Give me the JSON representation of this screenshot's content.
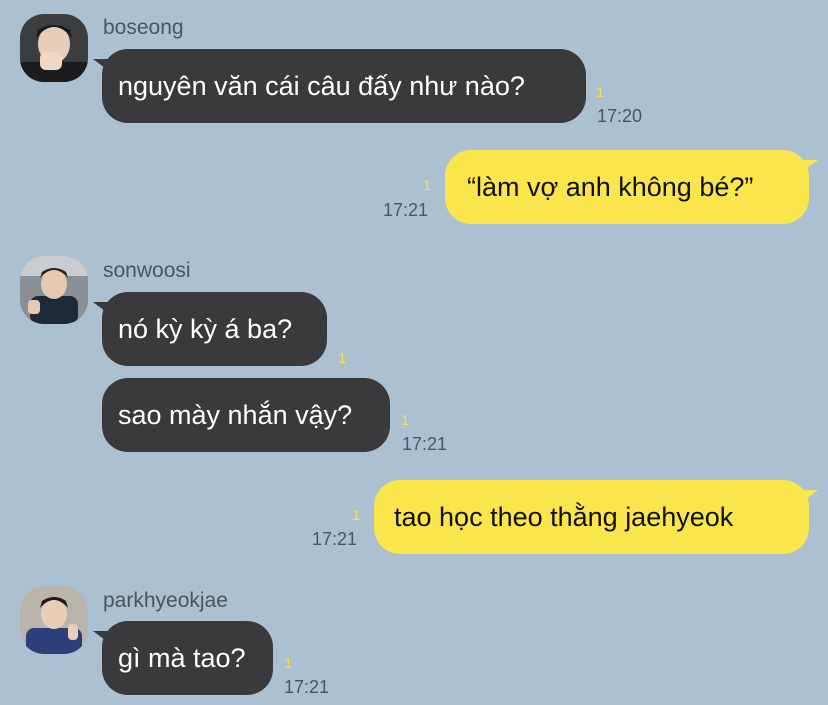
{
  "colors": {
    "background": "#abc1d1",
    "incoming_bubble": "#3a3a3c",
    "outgoing_bubble": "#fae54d",
    "read_count": "#f3e04a"
  },
  "messages": [
    {
      "sender": "boseong",
      "text": "nguyên văn cái câu đấy như nào?",
      "read": "1",
      "time": "17:20"
    },
    {
      "text": "“làm vợ anh không bé?”",
      "read": "1",
      "time": "17:21"
    },
    {
      "sender": "sonwoosi",
      "text": "nó kỳ kỳ á ba?",
      "read": "1"
    },
    {
      "text": "sao mày nhắn vậy?",
      "read": "1",
      "time": "17:21"
    },
    {
      "text": "tao học theo thằng jaehyeok",
      "read": "1",
      "time": "17:21"
    },
    {
      "sender": "parkhyeokjae",
      "text": "gì mà tao?",
      "read": "1",
      "time": "17:21"
    }
  ],
  "avatars": [
    "user-avatar-boseong",
    "user-avatar-sonwoosi",
    "user-avatar-parkhyeokjae"
  ]
}
